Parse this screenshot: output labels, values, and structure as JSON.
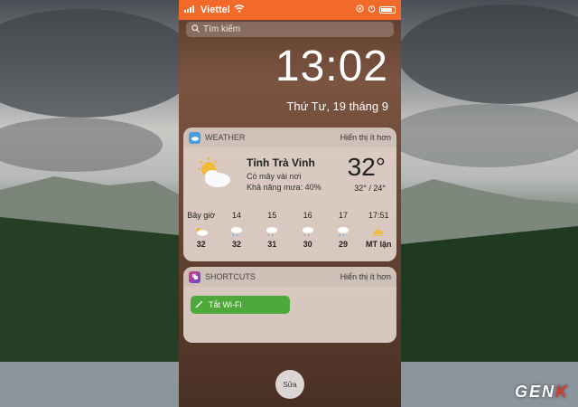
{
  "status_bar": {
    "carrier": "Viettel",
    "battery_color": "#ffffff",
    "bar_color": "#f26a2a"
  },
  "search": {
    "placeholder": "Tìm kiếm"
  },
  "lock": {
    "time": "13:02",
    "date": "Thứ Tư, 19 tháng 9"
  },
  "weather": {
    "app_name": "WEATHER",
    "toggle": "Hiển thị ít hơn",
    "city": "Tỉnh Trà Vinh",
    "description": "Có mây vài nơi",
    "rain": "Khả năng mưa: 40%",
    "temp": "32°",
    "range": "32° / 24°",
    "hours": [
      {
        "label": "Bây giờ",
        "icon": "cloudy-icon",
        "temp": "32"
      },
      {
        "label": "14",
        "icon": "rain-cloud-icon",
        "temp": "32"
      },
      {
        "label": "15",
        "icon": "rain-cloud-icon",
        "temp": "31"
      },
      {
        "label": "16",
        "icon": "rain-cloud-icon",
        "temp": "30"
      },
      {
        "label": "17",
        "icon": "rain-cloud-icon",
        "temp": "29"
      },
      {
        "label": "17:51",
        "icon": "sunset-icon",
        "temp": "MT lặn"
      }
    ]
  },
  "shortcuts": {
    "app_name": "SHORTCUTS",
    "toggle": "Hiển thị ít hơn",
    "button_label": "Tắt Wi-Fi"
  },
  "edit_button": "Sửa",
  "watermark": {
    "prefix": "GEN",
    "accent": "K"
  }
}
